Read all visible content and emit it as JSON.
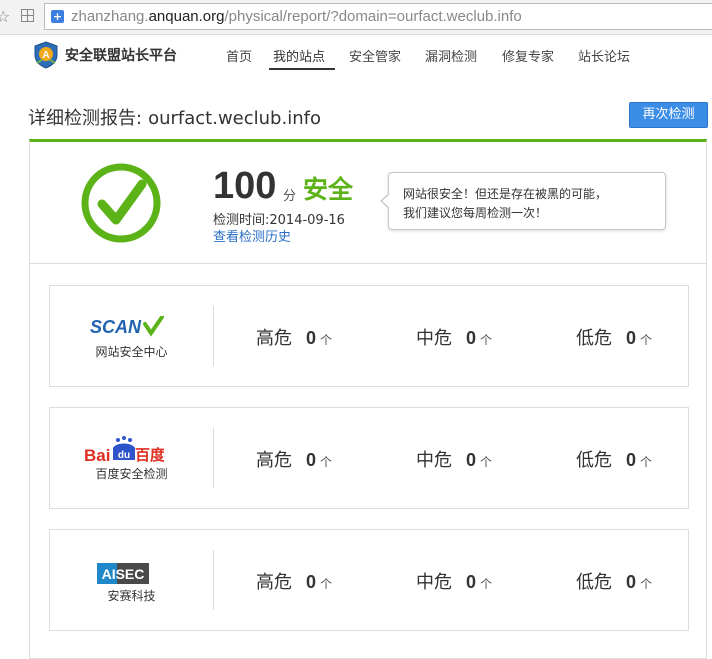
{
  "browser": {
    "url_prefix": "zhanzhang.",
    "url_domain": "anquan.org",
    "url_path": "/physical/report/?domain=ourfact.weclub.info",
    "star_icon": "star-icon",
    "page_icon": "page-icon"
  },
  "header": {
    "brand": "安全联盟站长平台",
    "nav": [
      "首页",
      "我的站点",
      "安全管家",
      "漏洞检测",
      "修复专家",
      "站长论坛"
    ],
    "active_nav": "我的站点"
  },
  "report": {
    "title_label": "详细检测报告:",
    "domain": "ourfact.weclub.info",
    "recheck_label": "再次检测",
    "score": "100",
    "score_unit": "分",
    "level": "安全",
    "date_label": "检测时间:2014-09-16",
    "history_link": "查看检测历史",
    "tip_line1": "网站很安全！但还是存在被黑的可能，",
    "tip_line2": "我们建议您每周检测一次！",
    "accent_color": "#5bb318",
    "link_color": "#2a6fc9",
    "button_color": "#3c8de6"
  },
  "engines": [
    {
      "logo_text": "SCAN",
      "name": "网站安全中心",
      "high_label": "高危",
      "high": "0",
      "mid_label": "中危",
      "mid": "0",
      "low_label": "低危",
      "low": "0",
      "unit": "个"
    },
    {
      "logo_text_red": "Bai",
      "logo_text_du": "du",
      "logo_text_cn": "百度",
      "name": "百度安全检测",
      "high_label": "高危",
      "high": "0",
      "mid_label": "中危",
      "mid": "0",
      "low_label": "低危",
      "low": "0",
      "unit": "个"
    },
    {
      "logo_text": "AISEC",
      "name": "安赛科技",
      "high_label": "高危",
      "high": "0",
      "mid_label": "中危",
      "mid": "0",
      "low_label": "低危",
      "low": "0",
      "unit": "个"
    }
  ]
}
